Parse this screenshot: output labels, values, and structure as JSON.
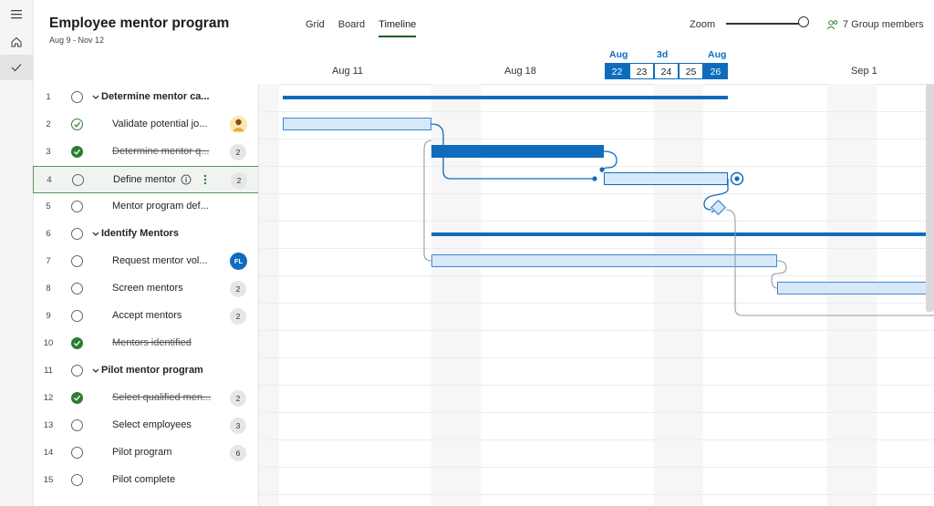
{
  "header": {
    "title": "Employee mentor program",
    "date_range": "Aug 9 - Nov 12",
    "tabs": [
      "Grid",
      "Board",
      "Timeline"
    ],
    "active_tab": "Timeline",
    "zoom_label": "Zoom",
    "members_label": "7 Group members"
  },
  "timeline": {
    "dates": [
      "Aug 11",
      "Aug 18",
      "Sep 1"
    ],
    "selection": {
      "start_month": "Aug",
      "duration": "3d",
      "end_month": "Aug",
      "days": [
        "22",
        "23",
        "24",
        "25",
        "26"
      ]
    }
  },
  "tasks": [
    {
      "num": "1",
      "name": "Determine mentor ca...",
      "type": "group",
      "status": "open"
    },
    {
      "num": "2",
      "name": "Validate potential jo...",
      "type": "task",
      "status": "check",
      "assignee": "avatar"
    },
    {
      "num": "3",
      "name": "Determine mentor q...",
      "type": "task",
      "status": "done",
      "badge": "2"
    },
    {
      "num": "4",
      "name": "Define mentor",
      "type": "task",
      "status": "open",
      "badge": "2",
      "selected": true
    },
    {
      "num": "5",
      "name": "Mentor program def...",
      "type": "task",
      "status": "open"
    },
    {
      "num": "6",
      "name": "Identify Mentors",
      "type": "group",
      "status": "open"
    },
    {
      "num": "7",
      "name": "Request mentor vol...",
      "type": "task",
      "status": "open",
      "assignee": "FL"
    },
    {
      "num": "8",
      "name": "Screen mentors",
      "type": "task",
      "status": "open",
      "badge": "2"
    },
    {
      "num": "9",
      "name": "Accept mentors",
      "type": "task",
      "status": "open",
      "badge": "2"
    },
    {
      "num": "10",
      "name": "Mentors identified",
      "type": "task",
      "status": "done"
    },
    {
      "num": "11",
      "name": "Pilot mentor program",
      "type": "group",
      "status": "open"
    },
    {
      "num": "12",
      "name": "Select qualified men...",
      "type": "task",
      "status": "done",
      "badge": "2"
    },
    {
      "num": "13",
      "name": "Select employees",
      "type": "task",
      "status": "open",
      "badge": "3"
    },
    {
      "num": "14",
      "name": "Pilot program",
      "type": "task",
      "status": "open",
      "badge": "6"
    },
    {
      "num": "15",
      "name": "Pilot complete",
      "type": "task",
      "status": "open"
    }
  ],
  "colors": {
    "accent": "#0f6cbd",
    "bar_light": "#d7e8f8",
    "done_green": "#2e7d32",
    "avatar_fl": "#0f6cbd"
  },
  "icons": [
    "hamburger-icon",
    "home-icon",
    "checkmark-icon",
    "people-icon",
    "info-icon",
    "more-vertical-icon",
    "chevron-down-icon"
  ]
}
